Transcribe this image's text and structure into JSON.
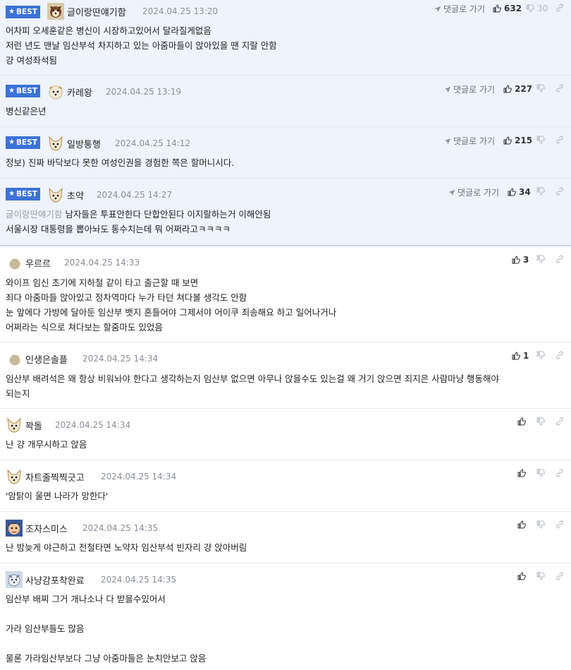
{
  "ui": {
    "best_label": "BEST",
    "reply_label": "댓글로 가기"
  },
  "comments": [
    {
      "nick": "글이랑딴얘기함",
      "date": "2024.04.25 13:20",
      "likes": "632",
      "dislikes": "30",
      "lines": [
        "어차피 오세훈같은 병신이 시장하고있어서 달라질게없음",
        "저런 년도 맨날 임산부석 차지하고 있는 아줌마들이 앉아있을 땐 지랄 안함",
        "걍 여성좌석됨"
      ]
    },
    {
      "nick": "카레왕",
      "date": "2024.04.25 13:19",
      "likes": "227",
      "lines": [
        "병신같은년"
      ]
    },
    {
      "nick": "일방통행",
      "date": "2024.04.25 14:12",
      "likes": "215",
      "lines": [
        "정보) 진짜 바닥보다 못한 여성인권을 경험한 쪽은 할머니시다."
      ]
    },
    {
      "nick": "초약",
      "date": "2024.04.25 14:27",
      "likes": "34",
      "quote": "글이랑딴얘기함",
      "lines": [
        "남자들은 투표안한다 단합안된다 이지랄하는거 이해안됨",
        "서울시장 대통령을 뽑아놔도 통수치는데 뭐 어쩌라고ㅋㅋㅋㅋ"
      ]
    },
    {
      "nick": "우르르",
      "date": "2024.04.25 14:33",
      "likes": "3",
      "lines": [
        "와이프 임신 초기에 지하철 같이 타고 출근할 때 보면",
        "죄다 아줌마들 앉아있고 정차역마다 누가 타던 쳐다볼 생각도 안함",
        "눈 앞에다 가방에 달아둔 임산부 뱃지 흔들어야 그제서야 어이쿠 죄송해요 하고 일어나거나",
        "어쩌라는 식으로 쳐다보는 할줌마도 있었음"
      ]
    },
    {
      "nick": "인생은솔플",
      "date": "2024.04.25 14:34",
      "likes": "1",
      "lines": [
        "임산부 배려석은 왜 항상 비워놔야 한다고 생각하는지 임산부 없으면 아무나 앉을수도 있는걸 왜 거기 앉으면 죄지은 사람마냥 행동해야",
        "되는지"
      ]
    },
    {
      "nick": "꽉돌",
      "date": "2024.04.25 14:34",
      "lines": [
        "난 걍 개무시하고 앉음"
      ]
    },
    {
      "nick": "차트줄찍찍긋고",
      "date": "2024.04.25 14:34",
      "lines": [
        "'암탉이 울면 나라가 망한다'"
      ]
    },
    {
      "nick": "조자스미스",
      "date": "2024.04.25 14:35",
      "lines": [
        "난 밤늦게 야근하고 전철타면 노약자 임산부석 빈자리 걍 앉아버림"
      ]
    },
    {
      "nick": "사냥감포착완료",
      "date": "2024.04.25 14:35",
      "lines": [
        "임산부 배찌 그거 개나소나 다 받을수있어서",
        "",
        "가라 임산부들도 많음",
        "",
        "물론 가라임산부보다 그냥 아줌마들은 눈치안보고 앉음"
      ]
    }
  ],
  "colors": {
    "best_badge": "#3b73d6",
    "best_background": "#eef3fc",
    "date_text": "#8a8f98"
  },
  "icons": {
    "reply": "paper-plane-icon",
    "like": "thumbs-up-icon",
    "dislike": "thumbs-down-icon",
    "link": "chain-link-icon"
  }
}
